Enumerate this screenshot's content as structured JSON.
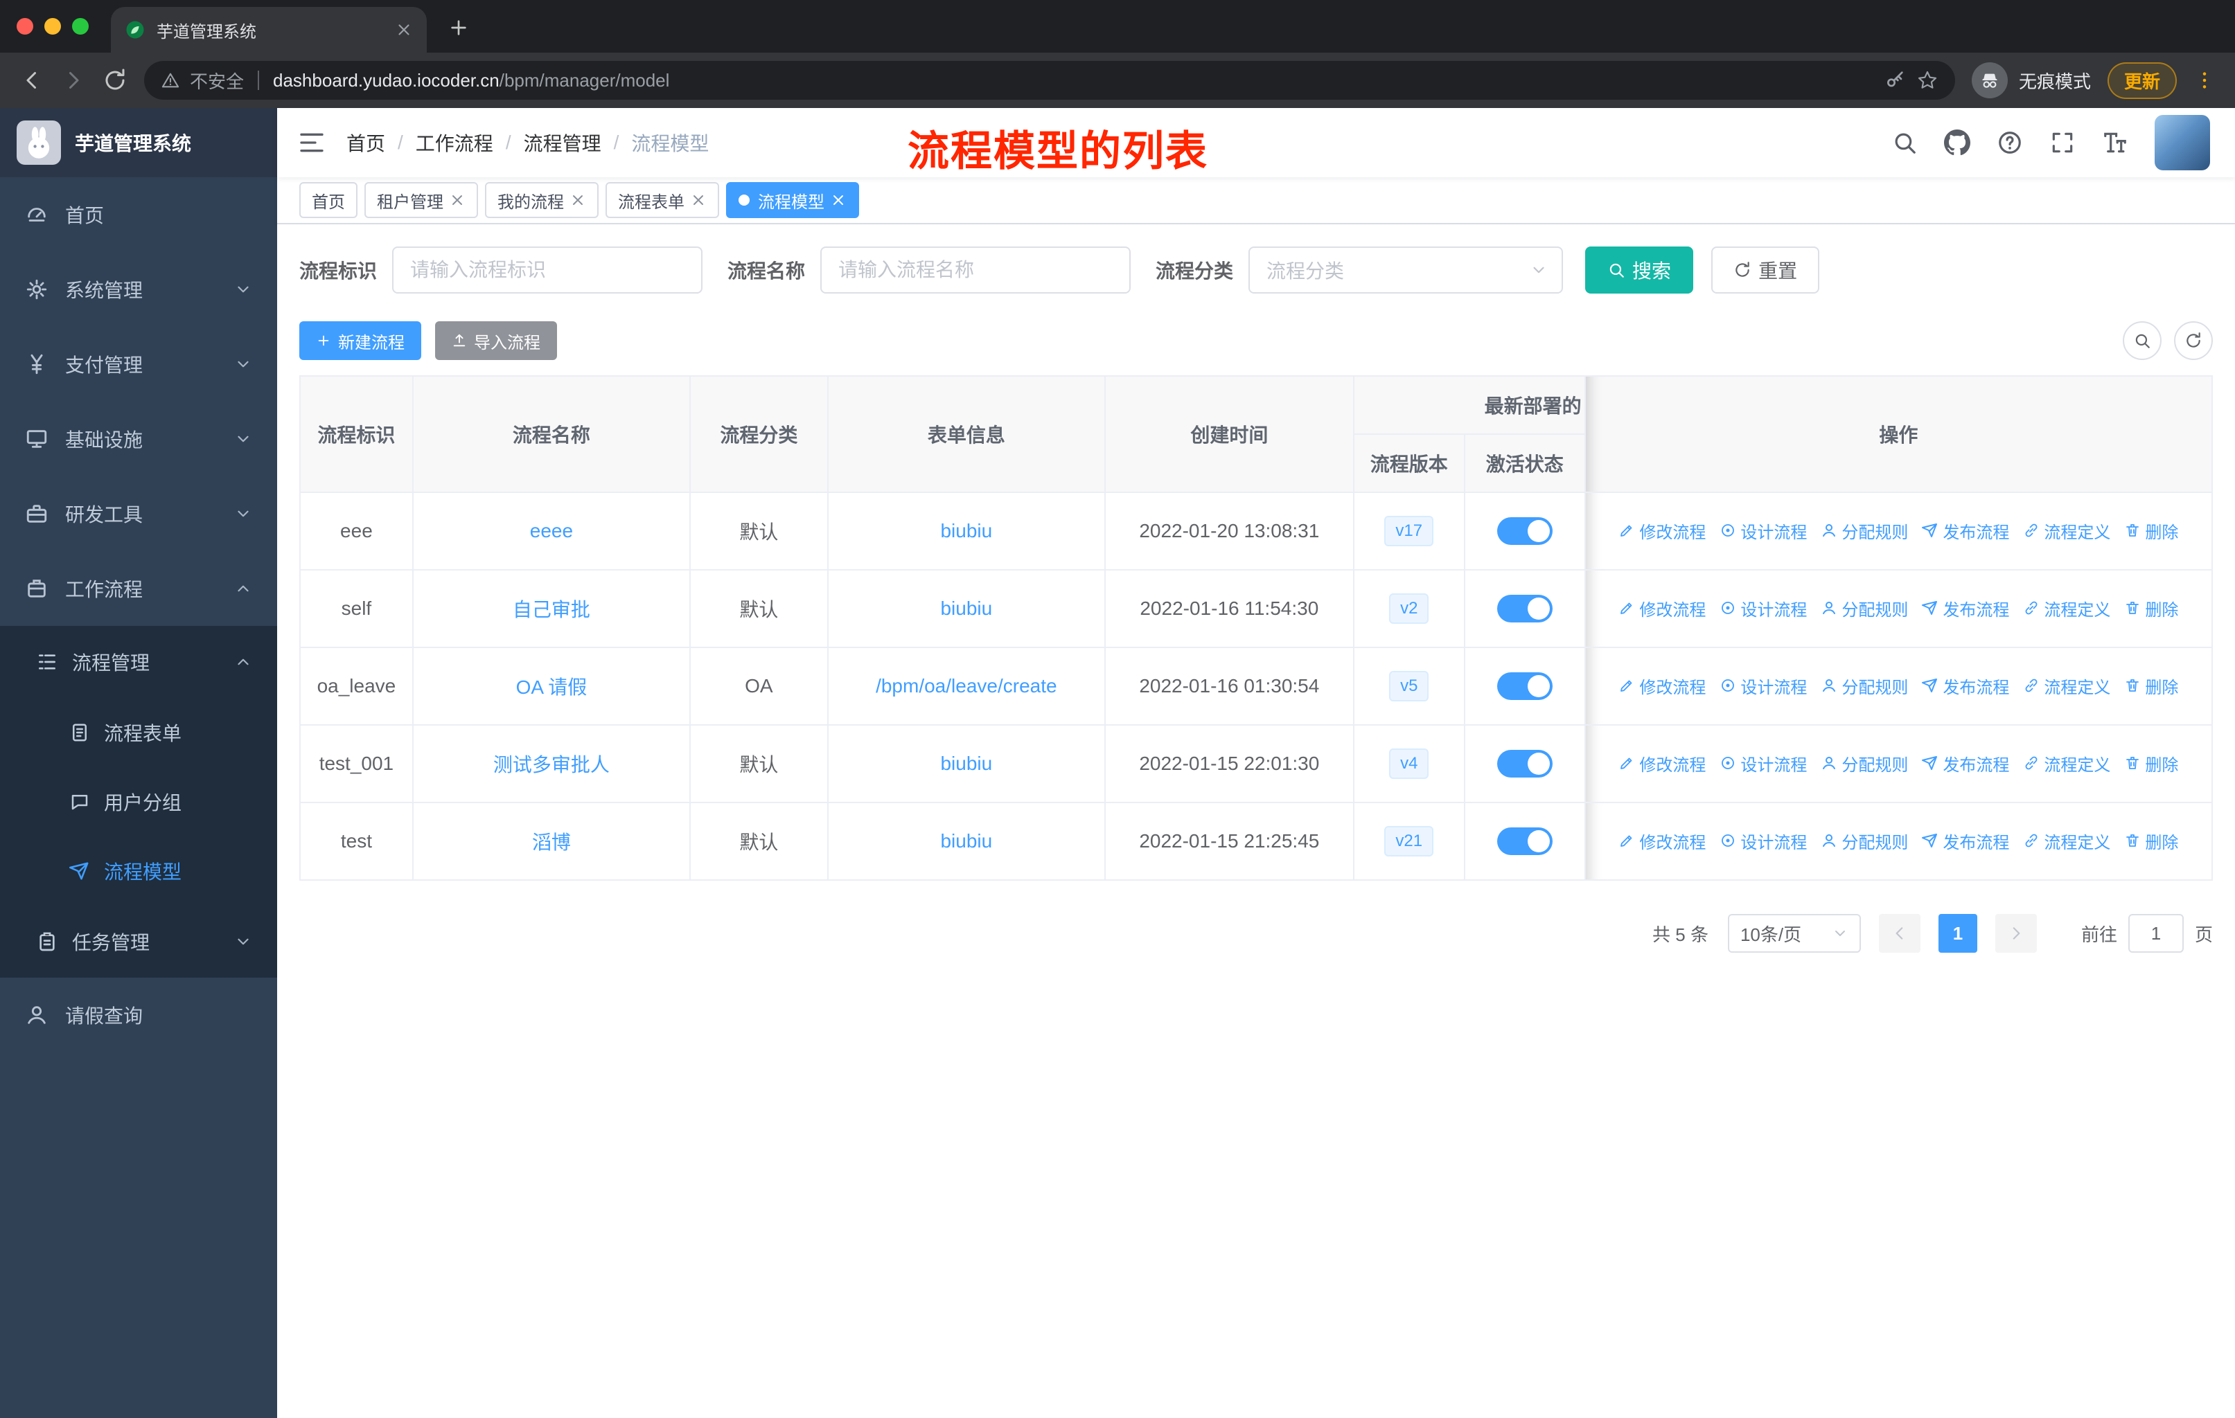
{
  "colors": {
    "accent": "#409eff",
    "search_button": "#14b8a6",
    "annotation_red": "#ff2600",
    "sidebar_bg": "#304156",
    "submenu_bg": "#1f2d3d"
  },
  "browser": {
    "tab_title": "芋道管理系统",
    "security_label": "不安全",
    "url_host": "dashboard.yudao.iocoder.cn",
    "url_path": "/bpm/manager/model",
    "incognito_label": "无痕模式",
    "update_label": "更新"
  },
  "sidebar": {
    "logo": "芋道管理系统",
    "items": [
      {
        "label": "首页"
      },
      {
        "label": "系统管理"
      },
      {
        "label": "支付管理"
      },
      {
        "label": "基础设施"
      },
      {
        "label": "研发工具"
      },
      {
        "label": "工作流程"
      },
      {
        "label": "流程管理"
      },
      {
        "label": "流程表单"
      },
      {
        "label": "用户分组"
      },
      {
        "label": "流程模型"
      },
      {
        "label": "任务管理"
      },
      {
        "label": "请假查询"
      }
    ]
  },
  "header": {
    "breadcrumb": [
      "首页",
      "工作流程",
      "流程管理",
      "流程模型"
    ],
    "separator": "/",
    "annotation": "流程模型的列表"
  },
  "tags": [
    {
      "label": "首页"
    },
    {
      "label": "租户管理"
    },
    {
      "label": "我的流程"
    },
    {
      "label": "流程表单"
    },
    {
      "label": "流程模型"
    }
  ],
  "filters": {
    "id_label": "流程标识",
    "id_placeholder": "请输入流程标识",
    "name_label": "流程名称",
    "name_placeholder": "请输入流程名称",
    "category_label": "流程分类",
    "category_placeholder": "流程分类",
    "search_label": "搜索",
    "reset_label": "重置"
  },
  "toolbar": {
    "create_label": "新建流程",
    "import_label": "导入流程"
  },
  "table": {
    "headers": {
      "id": "流程标识",
      "name": "流程名称",
      "category": "流程分类",
      "form": "表单信息",
      "created": "创建时间",
      "deploy_group": "最新部署的",
      "version": "流程版本",
      "active": "激活状态",
      "actions": "操作"
    },
    "action_labels": [
      "修改流程",
      "设计流程",
      "分配规则",
      "发布流程",
      "流程定义",
      "删除"
    ],
    "rows": [
      {
        "id": "eee",
        "name": "eeee",
        "category": "默认",
        "form": "biubiu",
        "created": "2022-01-20 13:08:31",
        "version": "v17",
        "active": true
      },
      {
        "id": "self",
        "name": "自己审批",
        "category": "默认",
        "form": "biubiu",
        "created": "2022-01-16 11:54:30",
        "version": "v2",
        "active": true
      },
      {
        "id": "oa_leave",
        "name": "OA 请假",
        "category": "OA",
        "form": "/bpm/oa/leave/create",
        "created": "2022-01-16 01:30:54",
        "version": "v5",
        "active": true
      },
      {
        "id": "test_001",
        "name": "测试多审批人",
        "category": "默认",
        "form": "biubiu",
        "created": "2022-01-15 22:01:30",
        "version": "v4",
        "active": true
      },
      {
        "id": "test",
        "name": "滔博",
        "category": "默认",
        "form": "biubiu",
        "created": "2022-01-15 21:25:45",
        "version": "v21",
        "active": true
      }
    ]
  },
  "pagination": {
    "total": "共 5 条",
    "page_size": "10条/页",
    "page": "1",
    "goto_label": "前往",
    "goto_value": "1",
    "page_unit": "页"
  }
}
